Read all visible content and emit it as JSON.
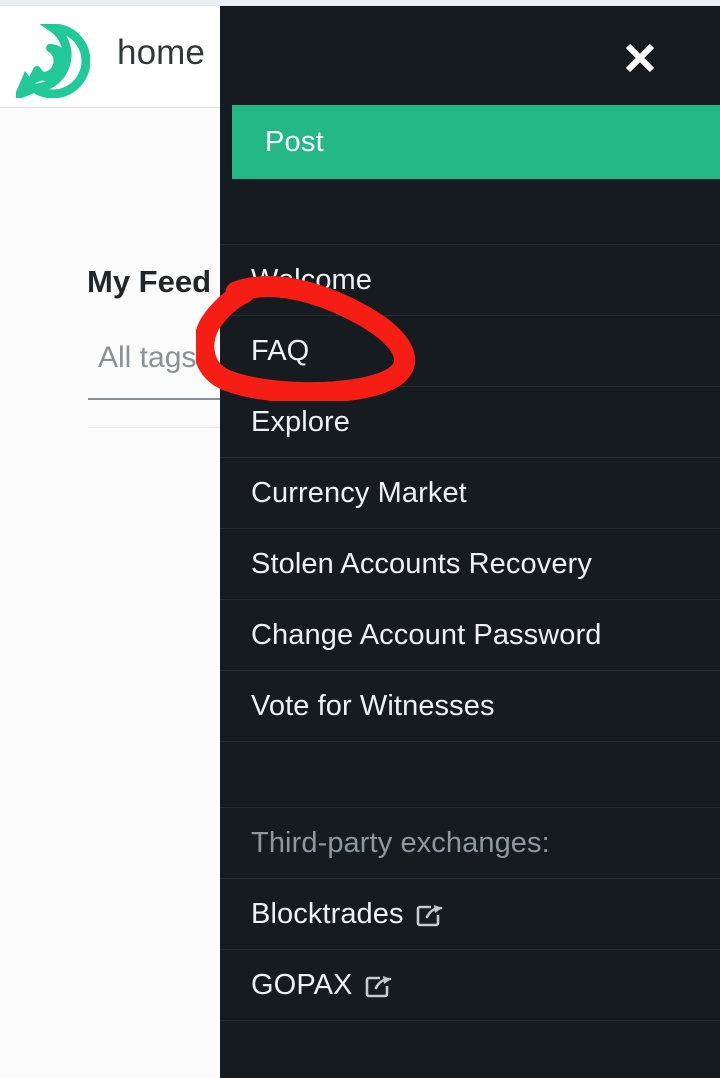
{
  "app": {
    "logo_icon": "steemit-chat-bubble-logo",
    "logo_color": "#20c997",
    "header_title": "home",
    "header_caret_icon": "chevron-down-icon"
  },
  "page": {
    "feed_title": "My Feed",
    "tag_filter_value": "All tags"
  },
  "menu": {
    "close_icon": "close-icon",
    "post_label": "Post",
    "post_color": "#25b887",
    "background_color": "#161b20",
    "items": [
      {
        "label": "Welcome",
        "icon": null
      },
      {
        "label": "FAQ",
        "icon": null
      },
      {
        "label": "Explore",
        "icon": null
      },
      {
        "label": "Currency Market",
        "icon": null
      },
      {
        "label": "Stolen Accounts Recovery",
        "icon": null
      },
      {
        "label": "Change Account Password",
        "icon": null
      },
      {
        "label": "Vote for Witnesses",
        "icon": null
      }
    ],
    "exchanges_heading": "Third-party exchanges:",
    "exchanges": [
      {
        "label": "Blocktrades",
        "icon": "external-link-icon"
      },
      {
        "label": "GOPAX",
        "icon": "external-link-icon"
      }
    ]
  },
  "annotation": {
    "shape": "hand-drawn-ellipse",
    "color": "#f61e14",
    "target": "FAQ"
  }
}
